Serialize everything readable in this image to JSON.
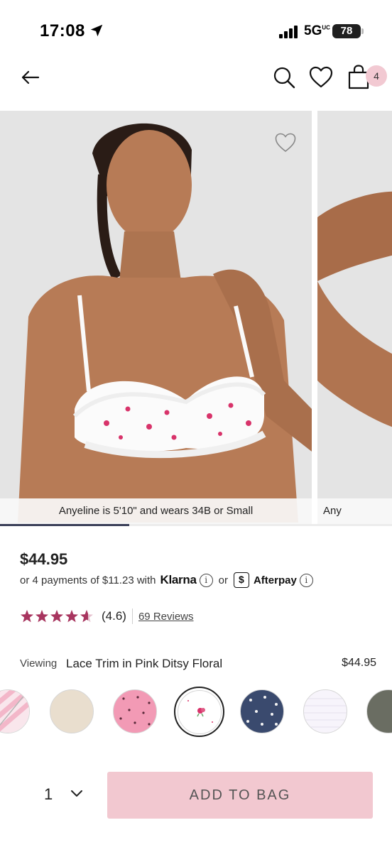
{
  "status_bar": {
    "time": "17:08",
    "network": "5G",
    "network_superscript": "UC",
    "battery": "78"
  },
  "header": {
    "back_icon": "arrow-left-icon",
    "search_icon": "search-icon",
    "wishlist_icon": "heart-icon",
    "bag_icon": "shopping-bag-icon",
    "bag_count": "4",
    "bag_badge_color": "#f2c9d2"
  },
  "gallery": {
    "captions": [
      "Anyeline is 5'10\" and wears 34B or Small",
      "Any"
    ],
    "wishlist_icon": "heart-outline-icon",
    "progress": 0.33
  },
  "product": {
    "price": "$44.95",
    "installments_text": "or 4 payments of $11.23 with",
    "klarna_label": "Klarna",
    "or_text": "or",
    "afterpay_label": "Afterpay",
    "info_glyph": "i",
    "rating": 4.6,
    "rating_label": "(4.6)",
    "star_color": "#a8355f",
    "reviews_label": "69 Reviews"
  },
  "variant": {
    "viewing_label": "Viewing",
    "name": "Lace Trim in Pink Ditsy Floral",
    "price": "$44.95"
  },
  "swatches": [
    {
      "name": "pink-white-stripe",
      "color": "#f5c9d6",
      "selected": false,
      "unavailable": true
    },
    {
      "name": "oatmeal-heather",
      "color": "#e8dccb",
      "selected": false
    },
    {
      "name": "pink-dot",
      "color": "#f29ab5",
      "selected": false
    },
    {
      "name": "pink-ditsy-floral",
      "color": "#ffffff",
      "selected": true
    },
    {
      "name": "navy-dot",
      "color": "#3a4a6e",
      "selected": false
    },
    {
      "name": "white-texture",
      "color": "#f7f4fb",
      "selected": false
    },
    {
      "name": "olive-grey",
      "color": "#6a6d62",
      "selected": false
    }
  ],
  "purchase": {
    "quantity": "1",
    "add_to_bag": "ADD TO BAG",
    "button_color": "#f2c8d0"
  }
}
